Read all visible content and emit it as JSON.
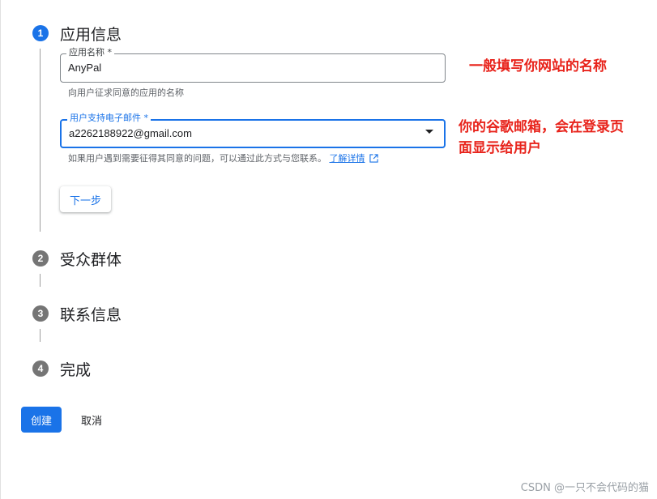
{
  "steps": [
    {
      "number": "1",
      "title": "应用信息",
      "state": "active"
    },
    {
      "number": "2",
      "title": "受众群体",
      "state": "inactive"
    },
    {
      "number": "3",
      "title": "联系信息",
      "state": "inactive"
    },
    {
      "number": "4",
      "title": "完成",
      "state": "inactive"
    }
  ],
  "form": {
    "app_name": {
      "label": "应用名称 *",
      "value": "AnyPal",
      "hint": "向用户征求同意的应用的名称"
    },
    "support_email": {
      "label": "用户支持电子邮件 *",
      "value": "a2262188922@gmail.com",
      "hint": "如果用户遇到需要征得其同意的问题，可以通过此方式与您联系。",
      "learn_more": "了解详情"
    },
    "next_label": "下一步"
  },
  "actions": {
    "create_label": "创建",
    "cancel_label": "取消"
  },
  "annotations": {
    "name_note": "一般填写你网站的名称",
    "email_note_line1": "你的谷歌邮箱，会在登录页",
    "email_note_line2": "面显示给用户"
  },
  "watermark": "CSDN @一只不会代码的猫",
  "colors": {
    "primary": "#1a73e8",
    "annotation": "#e8231b",
    "inactive_step": "#757575"
  }
}
